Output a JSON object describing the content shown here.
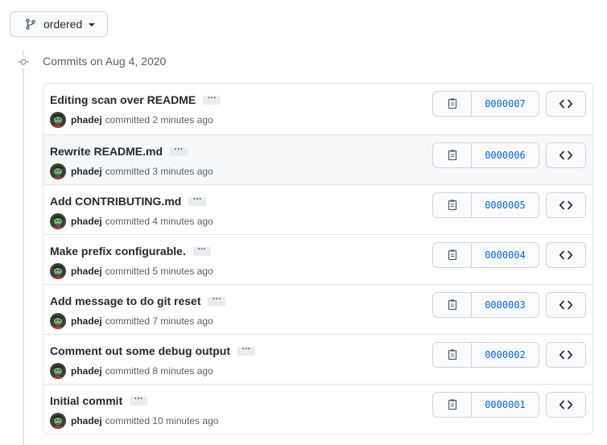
{
  "branch": {
    "name": "ordered",
    "icon": "git-branch-icon"
  },
  "group": {
    "title": "Commits on Aug 4, 2020"
  },
  "commits": [
    {
      "message": "Editing scan over README",
      "author": "phadej",
      "verb": "committed",
      "time": "2 minutes ago",
      "sha": "0000007"
    },
    {
      "message": "Rewrite README.md",
      "author": "phadej",
      "verb": "committed",
      "time": "3 minutes ago",
      "sha": "0000006"
    },
    {
      "message": "Add CONTRIBUTING.md",
      "author": "phadej",
      "verb": "committed",
      "time": "4 minutes ago",
      "sha": "0000005"
    },
    {
      "message": "Make prefix configurable.",
      "author": "phadej",
      "verb": "committed",
      "time": "5 minutes ago",
      "sha": "0000004"
    },
    {
      "message": "Add message to do git reset",
      "author": "phadej",
      "verb": "committed",
      "time": "7 minutes ago",
      "sha": "0000003"
    },
    {
      "message": "Comment out some debug output",
      "author": "phadej",
      "verb": "committed",
      "time": "8 minutes ago",
      "sha": "0000002"
    },
    {
      "message": "Initial commit",
      "author": "phadej",
      "verb": "committed",
      "time": "10 minutes ago",
      "sha": "0000001"
    }
  ],
  "labels": {
    "ellipsis": "···"
  },
  "colors": {
    "link": "#0366d6",
    "hover_row": "#f6f8fa",
    "border": "#e1e4e8"
  }
}
